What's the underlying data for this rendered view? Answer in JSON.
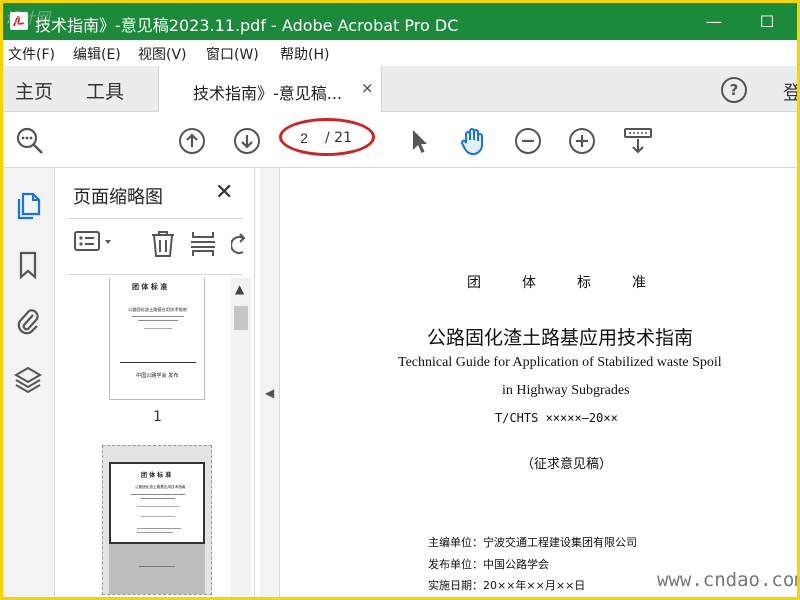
{
  "window": {
    "title": "技术指南》-意见稿2023.11.pdf - Adobe Acrobat Pro DC",
    "watermark_logo": "设计网",
    "minimize": "—",
    "maximize": "☐"
  },
  "menu": [
    "文件(F)",
    "编辑(E)",
    "视图(V)",
    "窗口(W)",
    "帮助(H)"
  ],
  "tabs": {
    "home": "主页",
    "tools": "工具",
    "document": "技术指南》-意见稿...",
    "close": "×",
    "help": "?",
    "signin": "登"
  },
  "toolbar": {
    "current_page": "2",
    "total_pages": "/ 21",
    "icons": [
      "zoom-search-icon",
      "page-up-icon",
      "page-down-icon",
      "select-cursor-icon",
      "hand-tool-icon",
      "zoom-out-icon",
      "zoom-in-icon",
      "scroll-mode-icon"
    ],
    "accent": "#1473e6",
    "annotation_color": "#d42020"
  },
  "sidebar": {
    "icons": [
      "page-thumbnails-icon",
      "bookmark-icon",
      "attachment-icon",
      "layers-icon"
    ]
  },
  "thumbnails_panel": {
    "title": "页面缩略图",
    "close": "✕",
    "page1_number": "1",
    "page1": {
      "header": "团 体 标 准",
      "title": "公路固化渣土路基应用技术指南",
      "publisher": "中国公路学会 发布"
    },
    "page2": {
      "header": "团 体 标 准",
      "title": "公路固化渣土路基应用技术指南"
    }
  },
  "document": {
    "header": [
      "团",
      "体",
      "标",
      "准"
    ],
    "title_cn": "公路固化渣土路基应用技术指南",
    "title_en_1": "Technical Guide for Application of Stabilized waste Spoil",
    "title_en_2": "in Highway Subgrades",
    "code": "T/CHTS ×××××—20××",
    "draft": "（征求意见稿）",
    "editor_unit": "主编单位：宁波交通工程建设集团有限公司",
    "publish_unit": "发布单位：中国公路学会",
    "effective_date": "实施日期：20××年××月××日"
  },
  "watermark": "www.cndao.com"
}
